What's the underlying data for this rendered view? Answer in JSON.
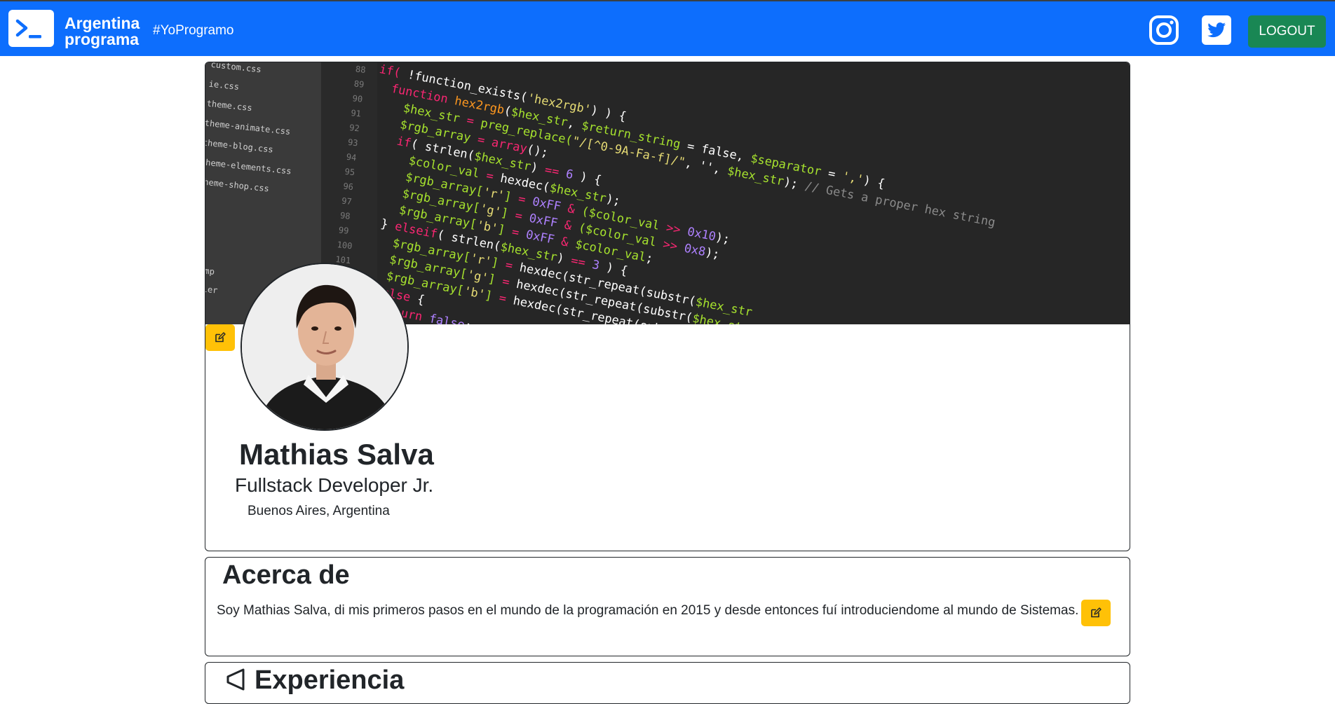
{
  "navbar": {
    "brand_line1": "Argentina",
    "brand_line2": "programa",
    "hashtag": "#YoProgramo",
    "logout_label": "LOGOUT",
    "icons": [
      "terminal-icon",
      "instagram-icon",
      "twitter-icon"
    ],
    "bg_color": "#0d6efd",
    "logout_color": "#198754"
  },
  "profile": {
    "name": "Mathias Salva",
    "title": "Fullstack Developer Jr.",
    "location": "Buenos Aires, Argentina",
    "banner_alt": "code editor screenshot",
    "edit_color": "#ffc107"
  },
  "about": {
    "heading": "Acerca de",
    "text": "Soy Mathias Salva, di mis primeros pasos en el mundo de la programación en 2015 y desde entonces fuí introduciendome al mundo de Sistemas."
  },
  "experience": {
    "heading": "Experiencia"
  }
}
